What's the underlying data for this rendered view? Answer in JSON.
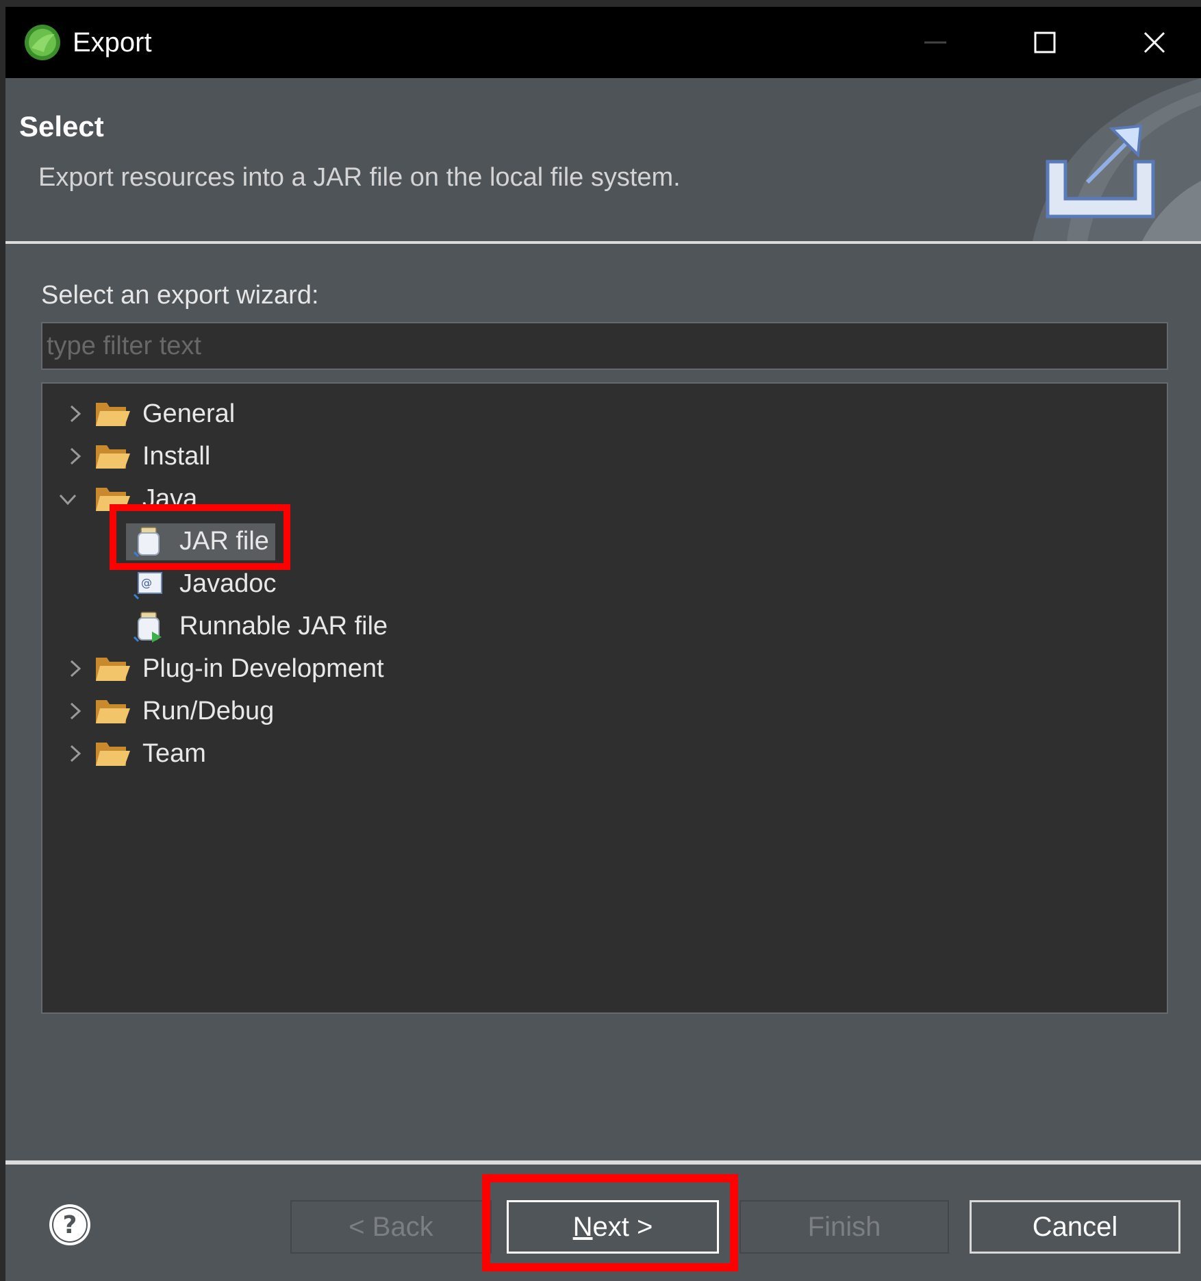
{
  "window": {
    "title": "Export"
  },
  "header": {
    "title": "Select",
    "description": "Export resources into a JAR file on the local file system."
  },
  "body": {
    "label": "Select an export wizard:",
    "filter_placeholder": "type filter text"
  },
  "tree": {
    "items": [
      {
        "label": "General",
        "expanded": false
      },
      {
        "label": "Install",
        "expanded": false
      },
      {
        "label": "Java",
        "expanded": true,
        "children": [
          {
            "label": "JAR file",
            "selected": true
          },
          {
            "label": "Javadoc"
          },
          {
            "label": "Runnable JAR file"
          }
        ]
      },
      {
        "label": "Plug-in Development",
        "expanded": false
      },
      {
        "label": "Run/Debug",
        "expanded": false
      },
      {
        "label": "Team",
        "expanded": false
      }
    ]
  },
  "buttons": {
    "back": "< Back",
    "next_mnemonic": "N",
    "next_rest": "ext >",
    "finish": "Finish",
    "cancel": "Cancel"
  },
  "colors": {
    "dialog_bg": "#50555a",
    "tree_bg": "#2f2f2f",
    "highlight": "#ff0000",
    "folder": "#f0c060"
  },
  "icons": {
    "app": "eclipse-spring-icon",
    "header": "export-icon",
    "help": "help-icon"
  }
}
